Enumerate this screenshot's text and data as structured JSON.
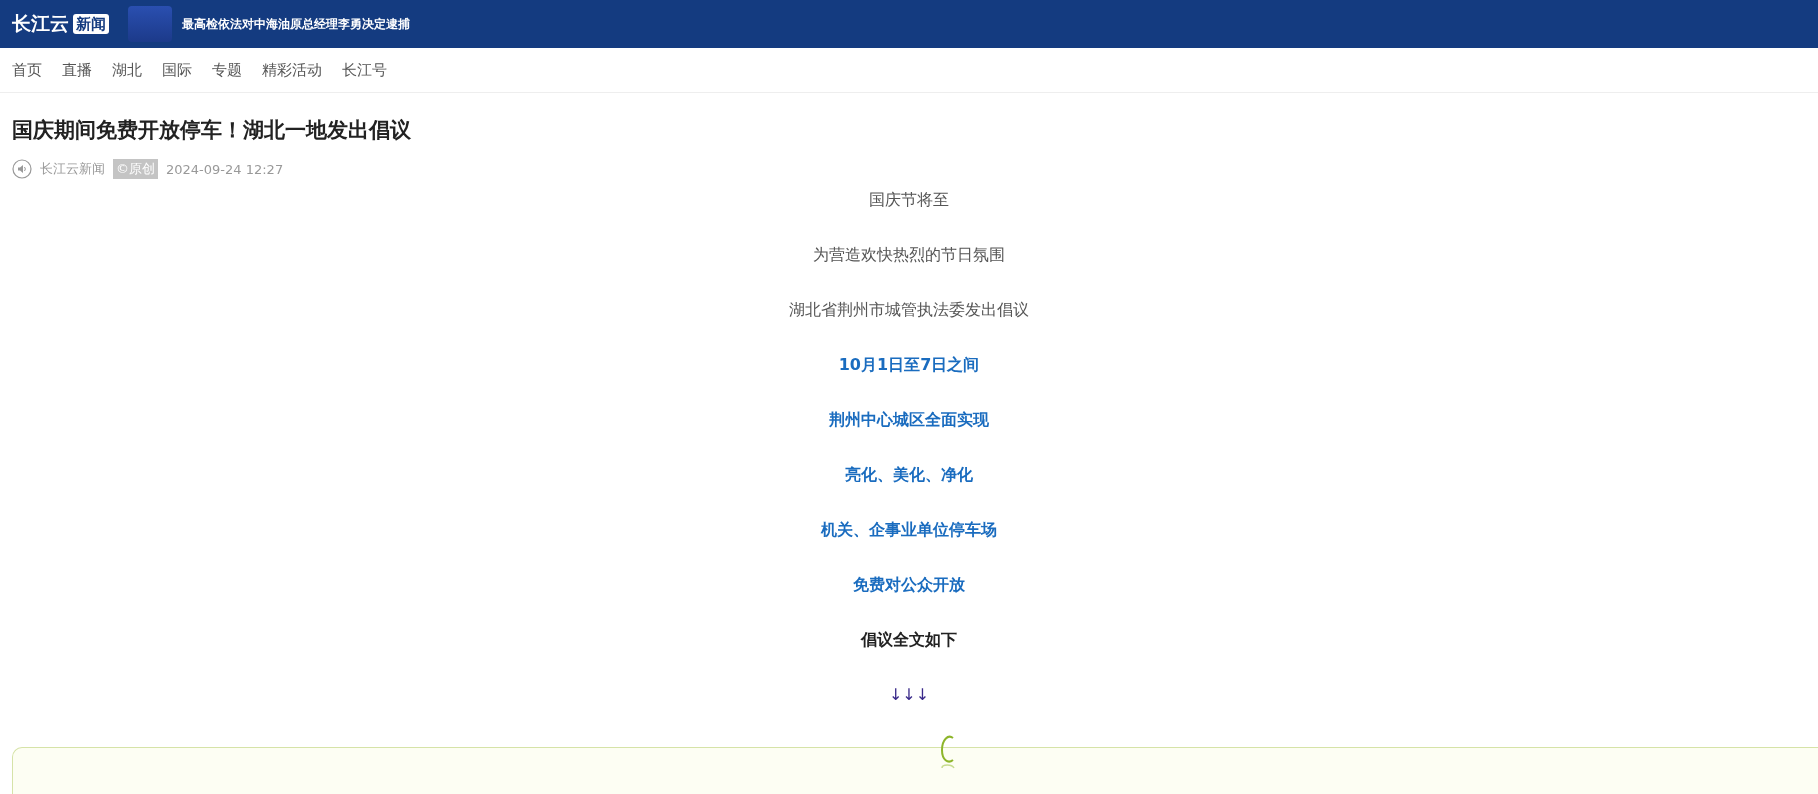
{
  "header": {
    "logo": {
      "name": "长江云",
      "tag": "新闻"
    },
    "headline": "最高检依法对中海油原总经理李勇决定逮捕"
  },
  "nav": [
    {
      "label": "首页"
    },
    {
      "label": "直播"
    },
    {
      "label": "湖北"
    },
    {
      "label": "国际"
    },
    {
      "label": "专题"
    },
    {
      "label": "精彩活动"
    },
    {
      "label": "长江号"
    }
  ],
  "article": {
    "title": "国庆期间免费开放停车！湖北一地发出倡议",
    "source": "长江云新闻",
    "badge": "©原创",
    "time": "2024-09-24 12:27",
    "paragraphs": [
      {
        "kind": "plain",
        "text": "国庆节将至"
      },
      {
        "kind": "plain",
        "text": "为营造欢快热烈的节日氛围"
      },
      {
        "kind": "plain",
        "text": "湖北省荆州市城管执法委发出倡议"
      },
      {
        "kind": "highlight",
        "text": "10月1日至7日之间"
      },
      {
        "kind": "highlight",
        "text": "荆州中心城区全面实现"
      },
      {
        "kind": "highlight",
        "text": "亮化、美化、净化"
      },
      {
        "kind": "highlight",
        "text": "机关、企事业单位停车场"
      },
      {
        "kind": "highlight",
        "text": "免费对公众开放"
      },
      {
        "kind": "strong",
        "text": "倡议全文如下"
      },
      {
        "kind": "arrows",
        "text": "↓↓↓"
      }
    ]
  }
}
